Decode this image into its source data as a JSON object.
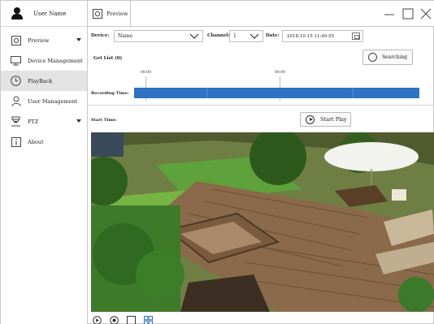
{
  "sidebar": {
    "user_name": "User Name",
    "items": [
      {
        "label": "Preview",
        "icon": "preview-icon",
        "has_caret": true
      },
      {
        "label": "Device Management",
        "icon": "monitor-icon",
        "has_caret": false
      },
      {
        "label": "PlayBack",
        "icon": "clock-icon",
        "has_caret": false,
        "active": true
      },
      {
        "label": "User Management",
        "icon": "user-icon",
        "has_caret": false
      },
      {
        "label": "PTZ",
        "icon": "ptz-camera-icon",
        "has_caret": true
      },
      {
        "label": "About",
        "icon": "info-icon",
        "has_caret": false
      }
    ]
  },
  "tab": {
    "label": "Preview"
  },
  "controls": {
    "device_label": "Device:",
    "device_value": "Name",
    "channel_label": "Channel:",
    "channel_value": "1",
    "date_label": "Date:",
    "date_value": "2018-10-15 11:49:55"
  },
  "playback": {
    "get_list_label": "Get List (0)",
    "searching_label": "Searching",
    "tick_labels": [
      "00:00",
      "00:00"
    ],
    "recording_time_label": "Recording Time:",
    "start_time_label": "Start Time:",
    "start_play_label": "Start Play"
  },
  "colors": {
    "accent": "#2f73c2",
    "active_menu_bg": "#e3e3e3"
  }
}
